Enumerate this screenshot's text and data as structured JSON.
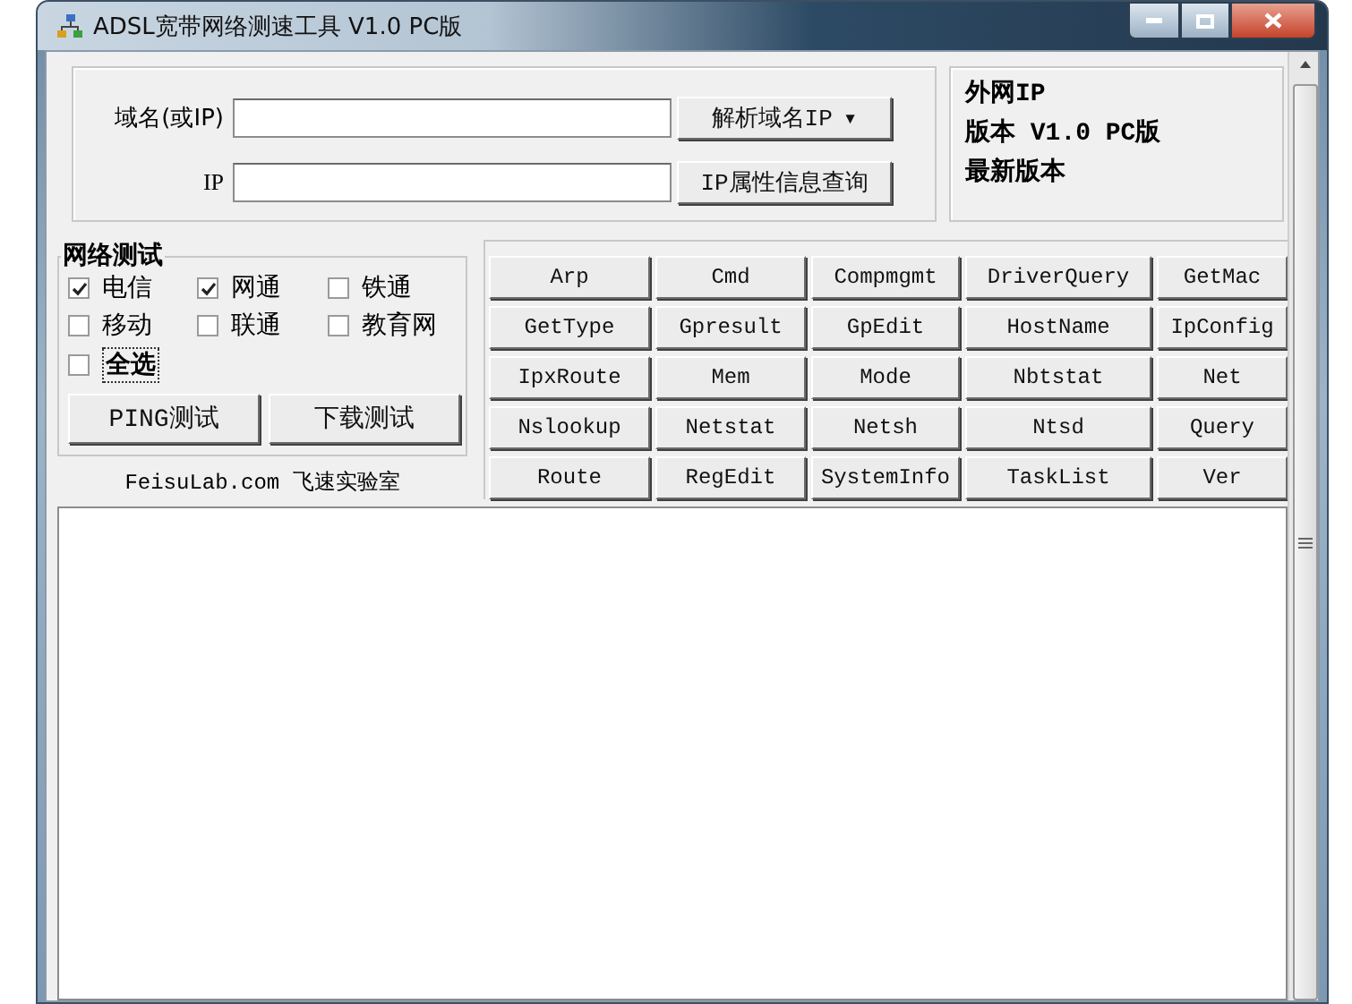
{
  "window": {
    "title": "ADSL宽带网络测速工具 V1.0 PC版"
  },
  "lookup": {
    "domain_label": "域名(或IP)",
    "ip_label": "IP",
    "resolve_button": "解析域名IP",
    "resolve_caret": "▾",
    "query_button": "IP属性信息查询"
  },
  "info": [
    "外网IP",
    "版本 V1.0 PC版",
    "最新版本"
  ],
  "network_test": {
    "title": "网络测试",
    "options": [
      {
        "label": "电信",
        "checked": true
      },
      {
        "label": "网通",
        "checked": true
      },
      {
        "label": "铁通",
        "checked": false
      },
      {
        "label": "移动",
        "checked": false
      },
      {
        "label": "联通",
        "checked": false
      },
      {
        "label": "教育网",
        "checked": false
      }
    ],
    "select_all": {
      "label": "全选",
      "checked": false
    },
    "buttons": [
      "PING测试",
      "下载测试"
    ],
    "footer": "FeisuLab.com 飞速实验室"
  },
  "commands": [
    "Arp",
    "Cmd",
    "Compmgmt",
    "DriverQuery",
    "GetMac",
    "GetType",
    "Gpresult",
    "GpEdit",
    "HostName",
    "IpConfig",
    "IpxRoute",
    "Mem",
    "Mode",
    "Nbtstat",
    "Net",
    "Nslookup",
    "Netstat",
    "Netsh",
    "Ntsd",
    "Query",
    "Route",
    "RegEdit",
    "SystemInfo",
    "TaskList",
    "Ver"
  ]
}
